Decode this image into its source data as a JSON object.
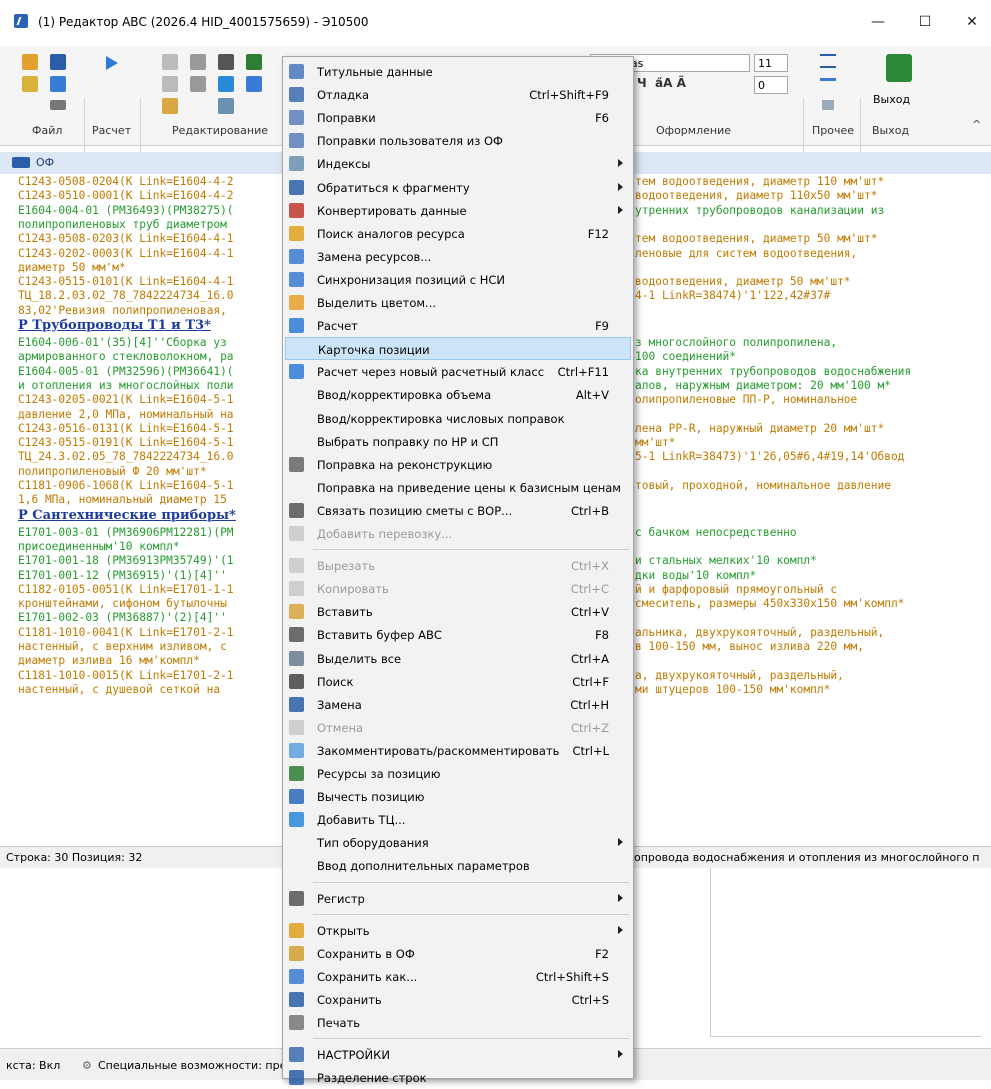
{
  "window": {
    "title": "(1) Редактор АВС (2026.4 HID_4001575659) - Э10500",
    "minimize": "—",
    "maximize": "☐",
    "close": "✕"
  },
  "ribbon": {
    "groups": [
      "Файл",
      "Расчет",
      "Редактирование",
      "Оформление",
      "Прочее",
      "Выход"
    ],
    "font_name": "Consolas",
    "font_size": "11",
    "spacing": "0",
    "exit_label": "Выход",
    "collapse": "^"
  },
  "of_header": {
    "label": "ОФ"
  },
  "editor": {
    "lines": [
      {
        "text": "C1243-0508-0204(K Link=E1604-4-2",
        "cls": "o",
        "right": "тем водоотведения, диаметр 110 мм'шт*"
      },
      {
        "text": "C1243-0510-0001(K Link=E1604-4-2",
        "cls": "o",
        "right": "водоотведения, диаметр 110х50 мм'шт*"
      },
      {
        "text": "E1604-004-01 (PM36493)(PM38275)(",
        "cls": "g",
        "right": "утренних трубопроводов канализации из"
      },
      {
        "text": "полипропиленовых труб диаметром",
        "cls": "g",
        "right": ""
      },
      {
        "text": "C1243-0508-0203(K Link=E1604-4-1",
        "cls": "o",
        "right": "тем водоотведения, диаметр 50 мм'шт*"
      },
      {
        "text": "C1243-0202-0003(K Link=E1604-4-1",
        "cls": "o",
        "right": "леновые для систем водоотведения,"
      },
      {
        "text": "диаметр 50 мм'м*",
        "cls": "o",
        "right": ""
      },
      {
        "text": "C1243-0515-0101(K Link=E1604-4-1",
        "cls": "o",
        "right": "водоотведения, диаметр 50 мм'шт*"
      },
      {
        "text": "ТЦ_18.2.03.02_78_7842224734_16.0",
        "cls": "o",
        "right": "4-1 LinkR=38474)'1'122,42#37#"
      },
      {
        "text": "83,02'Ревизия полипропиленовая,",
        "cls": "o",
        "right": ""
      },
      {
        "text": "Р Трубопроводы Т1 и Т3*",
        "cls": "h",
        "right": ""
      },
      {
        "text": "E1604-006-01'(35)[4]''Сборка уз",
        "cls": "g",
        "right": "з многослойного полипропилена,"
      },
      {
        "text": "армированного стекловолокном, ра",
        "cls": "g",
        "right": "100 соединений*"
      },
      {
        "text": "E1604-005-01 (PM32596)(PM36641)(",
        "cls": "g",
        "right": "ка внутренних трубопроводов водоснабжения"
      },
      {
        "text": "и отопления из многослойных поли",
        "cls": "g",
        "right": "алов, наружным диаметром: 20 мм'100 м*"
      },
      {
        "text": "C1243-0205-0021(K Link=E1604-5-1",
        "cls": "o",
        "right": "олипропиленовые ПП-Р, номинальное"
      },
      {
        "text": "давление 2,0 МПа, номинальный на",
        "cls": "o",
        "right": ""
      },
      {
        "text": "C1243-0516-0131(K Link=E1604-5-1",
        "cls": "o",
        "right": "лена PP-R, наружный диаметр 20 мм'шт*"
      },
      {
        "text": "C1243-0515-0191(K Link=E1604-5-1",
        "cls": "o",
        "right": "мм'шт*"
      },
      {
        "text": "ТЦ_24.3.02.05_78_7842224734_16.0",
        "cls": "o",
        "right": "5-1 LinkR=38473)'1'26,05#6,4#19,14'Обвод"
      },
      {
        "text": "полипропиленовый Ф 20 мм'шт*",
        "cls": "o",
        "right": ""
      },
      {
        "text": "C1181-0906-1068(K Link=E1604-5-1",
        "cls": "o",
        "right": "товый, проходной, номинальное давление"
      },
      {
        "text": "1,6 МПа, номинальный диаметр 15",
        "cls": "o",
        "right": ""
      },
      {
        "text": "Р Сантехнические приборы*",
        "cls": "h",
        "right": ""
      },
      {
        "text": "E1701-003-01 (PM36906PM12281)(PM",
        "cls": "g",
        "right": "с бачком непосредственно"
      },
      {
        "text": "присоединенным'10 компл*",
        "cls": "g",
        "right": ""
      },
      {
        "text": "E1701-001-18 (PM36913PM35749)'(1",
        "cls": "g",
        "right": "и стальных мелких'10 компл*"
      },
      {
        "text": "E1701-001-12 (PM36915)'(1)[4]''",
        "cls": "g",
        "right": "дки воды'10 компл*"
      },
      {
        "text": "C1182-0105-0051(K Link=E1701-1-1",
        "cls": "o",
        "right": "й и фарфоровый прямоугольный с"
      },
      {
        "text": "кронштейнами, сифоном бутылочны",
        "cls": "o",
        "right": "смеситель, размеры 450х330х150 мм'компл*"
      },
      {
        "text": "E1701-002-03 (PM36887)'(2)[4]''",
        "cls": "g",
        "right": ""
      },
      {
        "text": "C1181-1010-0041(K Link=E1701-2-1",
        "cls": "o",
        "right": "альника, двухрукояточный, раздельный,"
      },
      {
        "text": "настенный, с верхним изливом, с",
        "cls": "o",
        "right": "в 100-150 мм, вынос излива 220 мм,"
      },
      {
        "text": "диаметр излива 16 мм'компл*",
        "cls": "o",
        "right": ""
      },
      {
        "text": "C1181-1010-0015(K Link=E1701-2-1",
        "cls": "o",
        "right": "а, двухрукояточный, раздельный,"
      },
      {
        "text": "настенный, с душевой сеткой на",
        "cls": "o",
        "right": "ми штуцеров 100-150 мм'компл*"
      }
    ]
  },
  "status": {
    "row_pos": "Строка: 30  Позиция: 32",
    "right": "опровода водоснабжения и отопления из многослойного п"
  },
  "bottom": {
    "left": "кста: Вкл",
    "access": "Специальные возможности: пре"
  },
  "menu": {
    "items": [
      {
        "label": "Титульные данные",
        "sc": "",
        "icon": "title-data-icon",
        "color": "#4a78c0"
      },
      {
        "label": "Отладка",
        "sc": "Ctrl+Shift+F9",
        "icon": "debug-abc-icon",
        "color": "#3a6ab0"
      },
      {
        "label": "Поправки",
        "sc": "F6",
        "icon": "corrections-icon",
        "color": "#5a7fb8"
      },
      {
        "label": "Поправки пользователя из ОФ",
        "sc": "",
        "icon": "user-corrections-icon",
        "color": "#5a7fb8"
      },
      {
        "label": "Индексы",
        "sc": "",
        "icon": "indexes-icon",
        "color": "#6a8fb0",
        "sub": true
      },
      {
        "label": "Обратиться к фрагменту",
        "sc": "",
        "icon": "fragment-icon",
        "color": "#2c5fa8",
        "sub": true
      },
      {
        "label": "Конвертировать данные",
        "sc": "",
        "icon": "convert-icon",
        "color": "#c0392b",
        "sub": true
      },
      {
        "label": "Поиск аналогов ресурса",
        "sc": "F12",
        "icon": "analog-search-icon",
        "color": "#e0a020"
      },
      {
        "label": "Замена ресурсов...",
        "sc": "",
        "icon": "replace-resources-icon",
        "color": "#3a7bd5"
      },
      {
        "label": "Синхронизация позиций с НСИ",
        "sc": "",
        "icon": "sync-icon",
        "color": "#3a7bd5"
      },
      {
        "label": "Выделить цветом...",
        "sc": "",
        "icon": "color-mark-icon",
        "color": "#e8a02a"
      },
      {
        "label": "Расчет",
        "sc": "F9",
        "icon": "calc-play-icon",
        "color": "#2e7bd6"
      },
      {
        "label": "Карточка позиции",
        "sc": "",
        "icon": "",
        "color": "",
        "hl": true
      },
      {
        "label": "Расчет через новый расчетный класс",
        "sc": "Ctrl+F11",
        "icon": "calc-new-icon",
        "color": "#2e7bd6"
      },
      {
        "label": "Ввод/корректировка объема",
        "sc": "Alt+V",
        "icon": "",
        "color": ""
      },
      {
        "label": "Ввод/корректировка числовых поправок",
        "sc": "",
        "icon": "",
        "color": ""
      },
      {
        "label": "Выбрать поправку по НР и СП",
        "sc": "",
        "icon": "",
        "color": ""
      },
      {
        "label": "Поправка на реконструкцию",
        "sc": "",
        "icon": "reconstruction-icon",
        "color": "#666"
      },
      {
        "label": "Поправка на приведение цены к базисным ценам",
        "sc": "",
        "icon": "",
        "color": ""
      },
      {
        "label": "Связать позицию сметы с ВОР...",
        "sc": "Ctrl+B",
        "icon": "link-vor-icon",
        "color": "#555"
      },
      {
        "label": "Добавить перевозку...",
        "sc": "",
        "icon": "transport-icon",
        "color": "#aaa",
        "dis": true
      },
      {
        "sep": true
      },
      {
        "label": "Вырезать",
        "sc": "Ctrl+X",
        "icon": "cut-icon",
        "color": "#aaa",
        "dis": true
      },
      {
        "label": "Копировать",
        "sc": "Ctrl+C",
        "icon": "copy-icon",
        "color": "#aaa",
        "dis": true
      },
      {
        "label": "Вставить",
        "sc": "Ctrl+V",
        "icon": "paste-icon",
        "color": "#d9a640"
      },
      {
        "label": "Вставить буфер АВС",
        "sc": "F8",
        "icon": "paste-abc-icon",
        "color": "#555"
      },
      {
        "label": "Выделить все",
        "sc": "Ctrl+A",
        "icon": "select-all-icon",
        "color": "#6a7a90"
      },
      {
        "label": "Поиск",
        "sc": "Ctrl+F",
        "icon": "find-icon",
        "color": "#444"
      },
      {
        "label": "Замена",
        "sc": "Ctrl+H",
        "icon": "replace-icon",
        "color": "#2a5ea8"
      },
      {
        "label": "Отмена",
        "sc": "Ctrl+Z",
        "icon": "undo-icon",
        "color": "#aaa",
        "dis": true
      },
      {
        "label": "Закомментировать/раскомментировать",
        "sc": "Ctrl+L",
        "icon": "comment-icon",
        "color": "#5aa0e0"
      },
      {
        "label": "Ресурсы за позицию",
        "sc": "",
        "icon": "resources-icon",
        "color": "#2e7d32"
      },
      {
        "label": "Вычесть позицию",
        "sc": "",
        "icon": "subtract-icon",
        "color": "#2a6ab8"
      },
      {
        "label": "Добавить ТЦ...",
        "sc": "",
        "icon": "cart-icon",
        "color": "#2a8ad8"
      },
      {
        "label": "Тип оборудования",
        "sc": "",
        "icon": "",
        "color": "",
        "sub": true
      },
      {
        "label": "Ввод дополнительных параметров",
        "sc": "",
        "icon": "",
        "color": ""
      },
      {
        "sep": true
      },
      {
        "label": "Регистр",
        "sc": "",
        "icon": "register-icon",
        "color": "#555",
        "sub": true
      },
      {
        "sep": true
      },
      {
        "label": "Открыть",
        "sc": "",
        "icon": "open-icon",
        "color": "#e0a020",
        "sub": true
      },
      {
        "label": "Сохранить в ОФ",
        "sc": "F2",
        "icon": "save-of-icon",
        "color": "#d0a030"
      },
      {
        "label": "Сохранить как...",
        "sc": "Ctrl+Shift+S",
        "icon": "save-as-icon",
        "color": "#3a7bd5"
      },
      {
        "label": "Сохранить",
        "sc": "Ctrl+S",
        "icon": "save-icon",
        "color": "#2a5ea8"
      },
      {
        "label": "Печать",
        "sc": "",
        "icon": "print-icon",
        "color": "#777"
      },
      {
        "sep": true
      },
      {
        "label": "НАСТРОЙКИ",
        "sc": "",
        "icon": "settings-icon",
        "color": "#3a6ab0",
        "sub": true
      },
      {
        "label": "Разделение строк",
        "sc": "",
        "icon": "split-lines-icon",
        "color": "#2a5ea8"
      }
    ]
  }
}
